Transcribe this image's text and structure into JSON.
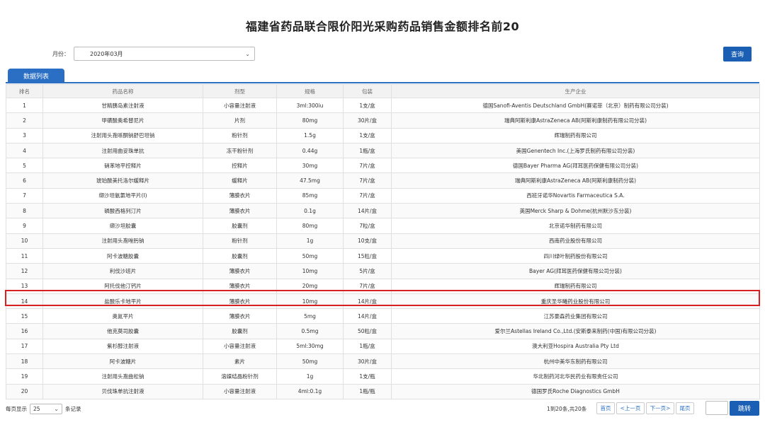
{
  "title": "福建省药品联合限价阳光采购药品销售金额排名前20",
  "filter": {
    "label": "月份：",
    "selected": "2020年03月"
  },
  "query_button": "查询",
  "tab_label": "数据列表",
  "columns": [
    "排名",
    "药品名称",
    "剂型",
    "规格",
    "包装",
    "生产企业"
  ],
  "rows": [
    [
      "1",
      "甘精胰岛素注射液",
      "小容量注射液",
      "3ml:300iu",
      "1支/盒",
      "德国Sanofi-Aventis Deutschland GmbH(赛诺菲（北京）制药有限公司分装)"
    ],
    [
      "2",
      "甲磺酸奥希替尼片",
      "片剂",
      "80mg",
      "30片/盒",
      "瑞典阿斯利康AstraZeneca AB(阿斯利康制药有限公司分装)"
    ],
    [
      "3",
      "注射用头孢哌酮钠舒巴坦钠",
      "粉针剂",
      "1.5g",
      "1支/盒",
      "辉瑞制药有限公司"
    ],
    [
      "4",
      "注射用曲妥珠单抗",
      "冻干粉针剂",
      "0.44g",
      "1瓶/盒",
      "美国Genentech Inc.(上海罗氏制药有限公司分装)"
    ],
    [
      "5",
      "硝苯地平控释片",
      "控释片",
      "30mg",
      "7片/盒",
      "德国Bayer Pharma AG(拜耳医药保健有限公司分装)"
    ],
    [
      "6",
      "琥珀酸美托洛尔缓释片",
      "缓释片",
      "47.5mg",
      "7片/盒",
      "瑞典阿斯利康AstraZeneca AB(阿斯利康制药分装)"
    ],
    [
      "7",
      "缬沙坦氨氯地平片(I)",
      "薄膜衣片",
      "85mg",
      "7片/盒",
      "西班牙诺华Novartis   Farmaceutica   S.A."
    ],
    [
      "8",
      "磷酸西格列汀片",
      "薄膜衣片",
      "0.1g",
      "14片/盒",
      "英国Merck Sharp & Dohme(杭州默沙东分装)"
    ],
    [
      "9",
      "缬沙坦胶囊",
      "胶囊剂",
      "80mg",
      "7粒/盒",
      "北京诺华制药有限公司"
    ],
    [
      "10",
      "注射用头孢唑肟钠",
      "粉针剂",
      "1g",
      "10支/盒",
      "西南药业股份有限公司"
    ],
    [
      "11",
      "阿卡波糖胶囊",
      "胶囊剂",
      "50mg",
      "15粒/盒",
      "四川绿叶制药股份有限公司"
    ],
    [
      "12",
      "利伐沙班片",
      "薄膜衣片",
      "10mg",
      "5片/盒",
      "Bayer AG(拜耳医药保健有限公司分装)"
    ],
    [
      "13",
      "阿托伐他汀钙片",
      "薄膜衣片",
      "20mg",
      "7片/盒",
      "辉瑞制药有限公司"
    ],
    [
      "14",
      "盐酸乐卡地平片",
      "薄膜衣片",
      "10mg",
      "14片/盒",
      "重庆圣华曦药业股份有限公司"
    ],
    [
      "15",
      "奥氮平片",
      "薄膜衣片",
      "5mg",
      "14片/盒",
      "江苏豪森药业集团有限公司"
    ],
    [
      "16",
      "他克莫司胶囊",
      "胶囊剂",
      "0.5mg",
      "50粒/盒",
      "爱尔兰Astellas Ireland Co.,Ltd.(安斯泰来制药(中国)有限公司分装)"
    ],
    [
      "17",
      "紫杉醇注射液",
      "小容量注射液",
      "5ml:30mg",
      "1瓶/盒",
      "澳大利亚Hospira Australia Pty Ltd"
    ],
    [
      "18",
      "阿卡波糖片",
      "素片",
      "50mg",
      "30片/盒",
      "杭州中美华东制药有限公司"
    ],
    [
      "19",
      "注射用头孢曲松钠",
      "溶媒结晶粉针剂",
      "1g",
      "1支/瓶",
      "华北制药河北华民药业有限责任公司"
    ],
    [
      "20",
      "贝伐珠单抗注射液",
      "小容量注射液",
      "4ml:0.1g",
      "1瓶/瓶",
      "德国罗氏Roche Diagnostics GmbH"
    ]
  ],
  "highlighted_row": 14,
  "footer": {
    "per_page_prefix": "每页显示",
    "per_page_value": "25",
    "per_page_suffix": "条记录",
    "summary": "1到20条,共20条",
    "first": "首页",
    "prev": "<上一页",
    "next": "下一页>",
    "last": "尾页",
    "jump": "跳转"
  },
  "colors": {
    "primary": "#1a5fb4",
    "tab": "#2a6fc4",
    "highlight": "#d82020"
  }
}
